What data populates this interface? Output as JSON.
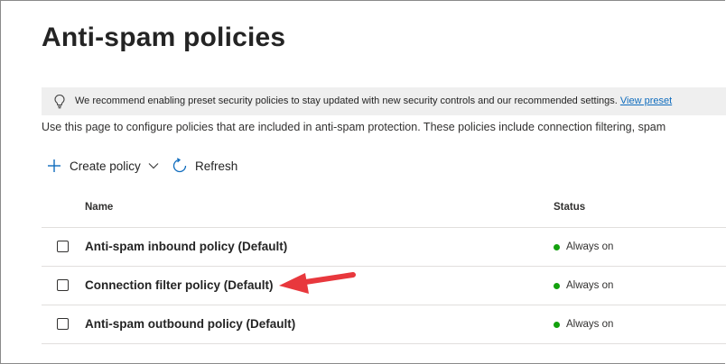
{
  "page": {
    "title": "Anti-spam policies"
  },
  "banner": {
    "text": "We recommend enabling preset security policies to stay updated with new security controls and our recommended settings.",
    "link": "View preset",
    "icon": "lightbulb-icon"
  },
  "description": "Use this page to configure policies that are included in anti-spam protection. These policies include connection filtering, spam",
  "toolbar": {
    "create_label": "Create policy",
    "refresh_label": "Refresh"
  },
  "table": {
    "columns": [
      "Name",
      "Status"
    ],
    "rows": [
      {
        "name": "Anti-spam inbound policy (Default)",
        "status": "Always on"
      },
      {
        "name": "Connection filter policy (Default)",
        "status": "Always on"
      },
      {
        "name": "Anti-spam outbound policy (Default)",
        "status": "Always on"
      }
    ]
  },
  "colors": {
    "status_on": "#13a10e",
    "accent_icon": "#0f6cbd",
    "annotation_arrow": "#e8383d"
  }
}
